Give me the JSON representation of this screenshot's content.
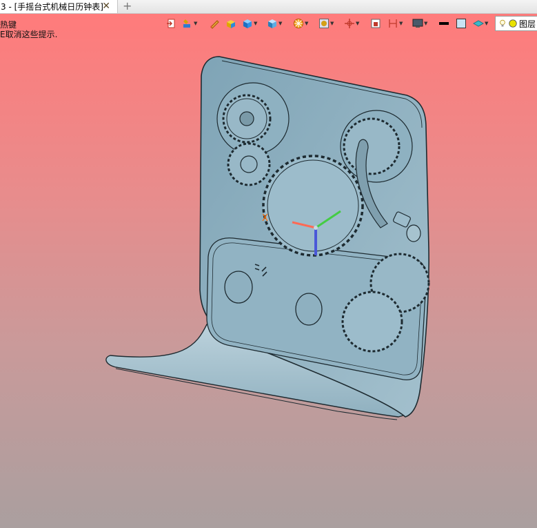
{
  "tab": {
    "title": "3 - [手摇台式机械日历钟表]",
    "close_glyph": "✕",
    "new_tab_glyph": "+"
  },
  "hints": {
    "line1": "热键",
    "line2": "E取消这些提示."
  },
  "view_toolbar": {
    "icons": [
      "exit-icon",
      "paint-icon",
      "pencil-icon",
      "box-shaded-icon",
      "cube-icon",
      "view-cube-icon",
      "render-wheel-icon",
      "display-filter-icon",
      "axis-icon",
      "section-icon",
      "dimension-icon",
      "monitor-icon",
      "line-color-icon",
      "fill-color-icon",
      "layer-plane-icon"
    ],
    "layer_label": "图层"
  },
  "colors": {
    "bg_top": "#ff7b7b",
    "bg_bottom": "#aa9f9f",
    "part_fill": "#8fb3c4",
    "part_edge": "#1d2a30",
    "axis_x": "#ff6a55",
    "axis_y": "#44cc44",
    "axis_z": "#4a58d8"
  }
}
